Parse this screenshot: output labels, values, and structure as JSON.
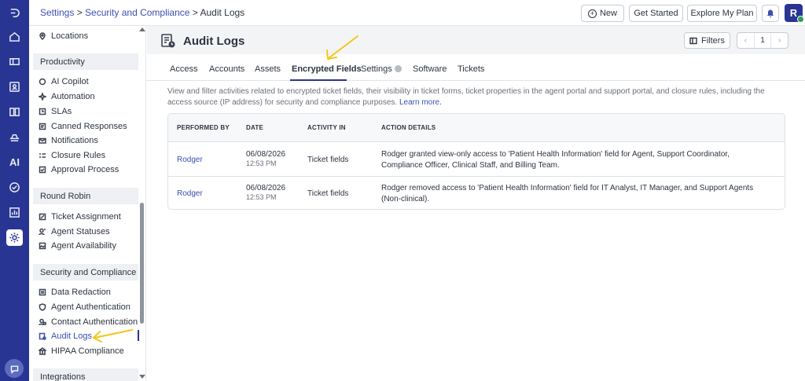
{
  "breadcrumb": {
    "settings": "Settings",
    "sep1": " > ",
    "security": "Security and Compliance",
    "sep2": " > ",
    "current": "Audit Logs"
  },
  "header": {
    "new_label": "New",
    "get_started_label": "Get Started",
    "explore_plan_label": "Explore My Plan",
    "avatar_initial": "R"
  },
  "sidebar": {
    "locations": "Locations",
    "groups": {
      "productivity": "Productivity",
      "round_robin": "Round Robin",
      "security": "Security and Compliance",
      "integrations": "Integrations"
    },
    "productivity_items": [
      "AI Copilot",
      "Automation",
      "SLAs",
      "Canned Responses",
      "Notifications",
      "Closure Rules",
      "Approval Process"
    ],
    "round_robin_items": [
      "Ticket Assignment",
      "Agent Statuses",
      "Agent Availability"
    ],
    "security_items": [
      "Data Redaction",
      "Agent Authentication",
      "Contact Authentication",
      "Audit Logs",
      "HIPAA Compliance"
    ]
  },
  "rail": {
    "ai_label": "AI"
  },
  "page": {
    "title": "Audit Logs",
    "filters_label": "Filters",
    "page_prev": "‹",
    "page_number": "1",
    "page_next": "›"
  },
  "tabs": [
    "Access",
    "Accounts",
    "Assets",
    "Encrypted Fields",
    "Settings",
    "Software",
    "Tickets"
  ],
  "description": {
    "text": "View and filter activities related to encrypted ticket fields, their visibility in ticket forms, ticket properties in the agent portal and support portal, and closure rules, including the access source (IP address) for security and compliance purposes.",
    "link": "Learn more."
  },
  "table": {
    "headers": [
      "PERFORMED BY",
      "DATE",
      "ACTIVITY IN",
      "ACTION DETAILS"
    ],
    "rows": [
      {
        "performed_by": "Rodger",
        "date": "06/08/2026",
        "time": "12:53 PM",
        "activity_in": "Ticket fields",
        "details": "Rodger granted view-only access to 'Patient Health Information' field for Agent, Support Coordinator, Compliance Officer, Clinical Staff, and Billing Team."
      },
      {
        "performed_by": "Rodger",
        "date": "06/08/2026",
        "time": "12:53 PM",
        "activity_in": "Ticket fields",
        "details": "Rodger removed access to 'Patient Health Information' field for IT Analyst, IT Manager, and Support Agents (Non-clinical)."
      }
    ]
  },
  "colors": {
    "rail": "#283593",
    "accent": "#3d4fb0",
    "annotation_arrow": "#f5c518",
    "online": "#2e9d57"
  }
}
